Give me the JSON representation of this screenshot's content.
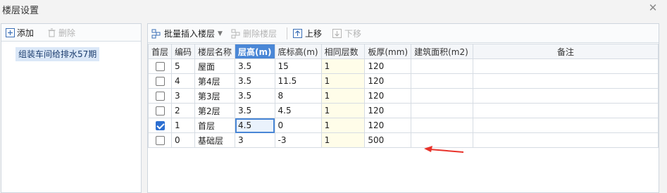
{
  "window": {
    "title": "楼层设置",
    "close_icon": "close-icon"
  },
  "left": {
    "add_label": "添加",
    "delete_label": "删除",
    "tree_item": "组装车间给排水57期"
  },
  "toolbar": {
    "batch_insert_label": "批量插入楼层",
    "delete_floor_label": "删除楼层",
    "move_up_label": "上移",
    "move_down_label": "下移"
  },
  "table": {
    "headers": [
      "首层",
      "编码",
      "楼层名称",
      "层高(m)",
      "底标高(m)",
      "相同层数",
      "板厚(mm)",
      "建筑面积(m2)",
      "备注"
    ],
    "rows": [
      {
        "first": false,
        "code": "5",
        "name": "屋面",
        "height": "3.5",
        "base": "15",
        "same": "1",
        "thick": "120",
        "area": "",
        "note": ""
      },
      {
        "first": false,
        "code": "4",
        "name": "第4层",
        "height": "3.5",
        "base": "11.5",
        "same": "1",
        "thick": "120",
        "area": "",
        "note": ""
      },
      {
        "first": false,
        "code": "3",
        "name": "第3层",
        "height": "3.5",
        "base": "8",
        "same": "1",
        "thick": "120",
        "area": "",
        "note": ""
      },
      {
        "first": false,
        "code": "2",
        "name": "第2层",
        "height": "3.5",
        "base": "4.5",
        "same": "1",
        "thick": "120",
        "area": "",
        "note": ""
      },
      {
        "first": true,
        "code": "1",
        "name": "首层",
        "height": "4.5",
        "base": "0",
        "same": "1",
        "thick": "120",
        "area": "",
        "note": ""
      },
      {
        "first": false,
        "code": "0",
        "name": "基础层",
        "height": "3",
        "base": "-3",
        "same": "1",
        "thick": "500",
        "area": "",
        "note": ""
      }
    ]
  },
  "colors": {
    "accent": "#4a87d6",
    "selection": "#dbe8f8",
    "arrow": "#e8322a",
    "yellow_cell": "#fffde9"
  }
}
